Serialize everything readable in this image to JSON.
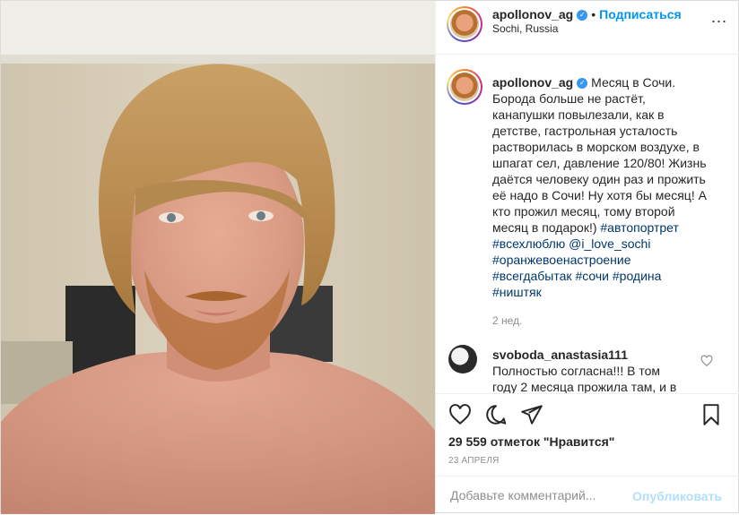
{
  "post": {
    "username": "apollonov_ag",
    "verified_icon": "verified-badge-icon",
    "dot": "•",
    "follow_label": "Подписаться",
    "location": "Sochi, Russia",
    "more": "..."
  },
  "caption": {
    "username": "apollonov_ag",
    "text_lines": [
      "Месяц в Сочи.",
      "Борода больше не растёт,",
      "канапушки повылезали, как в",
      "детстве, гастрольная усталость",
      "растворилась в морском воздухе, в",
      "шпагат сел, давление 120/80! Жизнь",
      "даётся человеку один раз и прожить",
      "её надо в Сочи! Ну хотя бы месяц! А",
      "кто прожил месяц, тому второй",
      "месяц в подарок!)"
    ],
    "tags": {
      "t1": "#автопортрет",
      "t2": "#всехлюблю",
      "mention": "@i_love_sochi",
      "t3": "#оранжевоенастроение",
      "t4": "#всегдабытак",
      "t5": "#сочи",
      "t6": "#родина",
      "t7": "#ништяк"
    },
    "time_ago": "2 нед."
  },
  "comment": {
    "username": "svoboda_anastasia111",
    "line1": "Полностью согласна!!! В том",
    "line2": "году 2 месяца прожила там, и в"
  },
  "stats": {
    "likes": "29 559 отметок \"Нравится\"",
    "date": "23 АПРЕЛЯ"
  },
  "compose": {
    "placeholder": "Добавьте комментарий...",
    "post_label": "Опубликовать"
  },
  "icons": {
    "like": "heart-icon",
    "comment": "comment-icon",
    "share": "share-icon",
    "save": "bookmark-icon"
  },
  "colors": {
    "link": "#00376b",
    "follow": "#0095f6",
    "publish_disabled": "#b2dffc",
    "muted": "#8e8e8e",
    "verified": "#3897f0"
  }
}
